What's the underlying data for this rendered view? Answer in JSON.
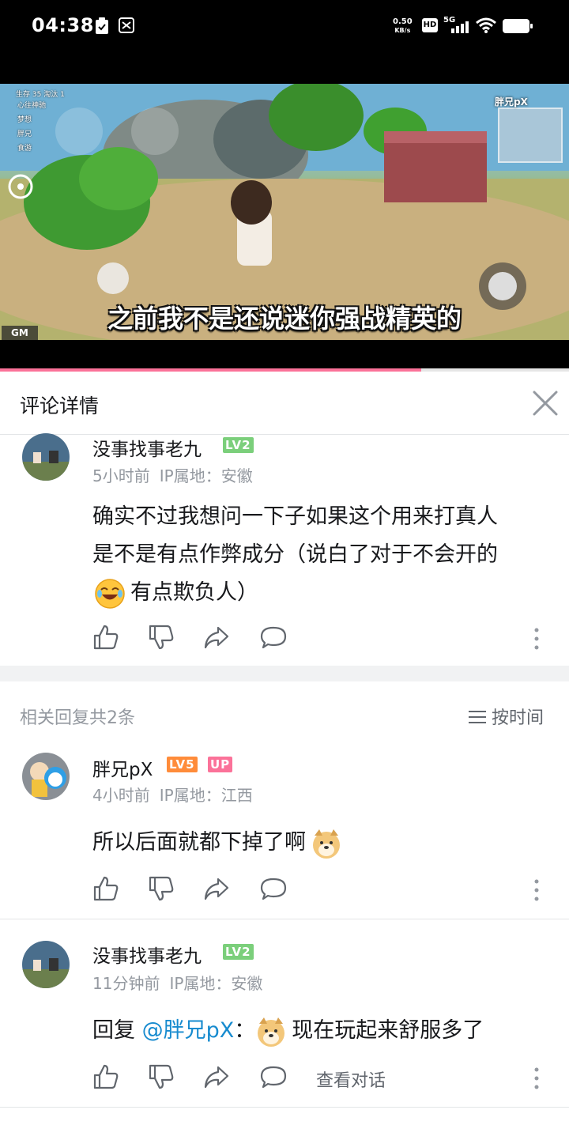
{
  "status_bar": {
    "time": "04:38",
    "net_speed_value": "0.50",
    "net_speed_unit": "KB/s",
    "hd": "HD",
    "network": "5G"
  },
  "video": {
    "subtitle": "之前我不是还说迷你强战精英的",
    "watermark": "胖兄pX",
    "gm_label": "GM",
    "hud_alive_label": "生存",
    "hud_alive_count": "35",
    "hud_eliminated_label": "淘汰",
    "hud_eliminated_count": "1",
    "hud_players": [
      "心往神驰",
      "梦想",
      "胖兄",
      "食游"
    ],
    "progress_fraction": 0.74
  },
  "panel": {
    "title": "评论详情",
    "close_icon": "close-icon"
  },
  "main_comment": {
    "username": "没事找事老九",
    "level": "LV2",
    "time": "5小时前",
    "ip": "IP属地：安徽",
    "text_line1": "确实不过我想问一下子如果这个用来打真人",
    "text_line2": "是不是有点作弊成分（说白了对于不会开的",
    "text_line3": "有点欺负人）"
  },
  "replies_header": {
    "count_label": "相关回复共2条",
    "sort_label": "按时间"
  },
  "replies": [
    {
      "username": "胖兄pX",
      "level": "LV5",
      "up_badge": "UP",
      "time": "4小时前",
      "ip": "IP属地：江西",
      "text": "所以后面就都下掉了啊"
    },
    {
      "username": "没事找事老九",
      "level": "LV2",
      "time": "11分钟前",
      "ip": "IP属地：安徽",
      "reply_prefix": "回复 ",
      "mention": "@胖兄pX",
      "colon": "：",
      "text": "现在玩起来舒服多了",
      "view_conversation": "查看对话"
    }
  ],
  "colors": {
    "accent_pink": "#fb7299",
    "lv2_green": "#7bcf7b",
    "lv5_orange": "#ff8c3a",
    "mention_blue": "#178bcf",
    "meta_gray": "#9499a0"
  }
}
